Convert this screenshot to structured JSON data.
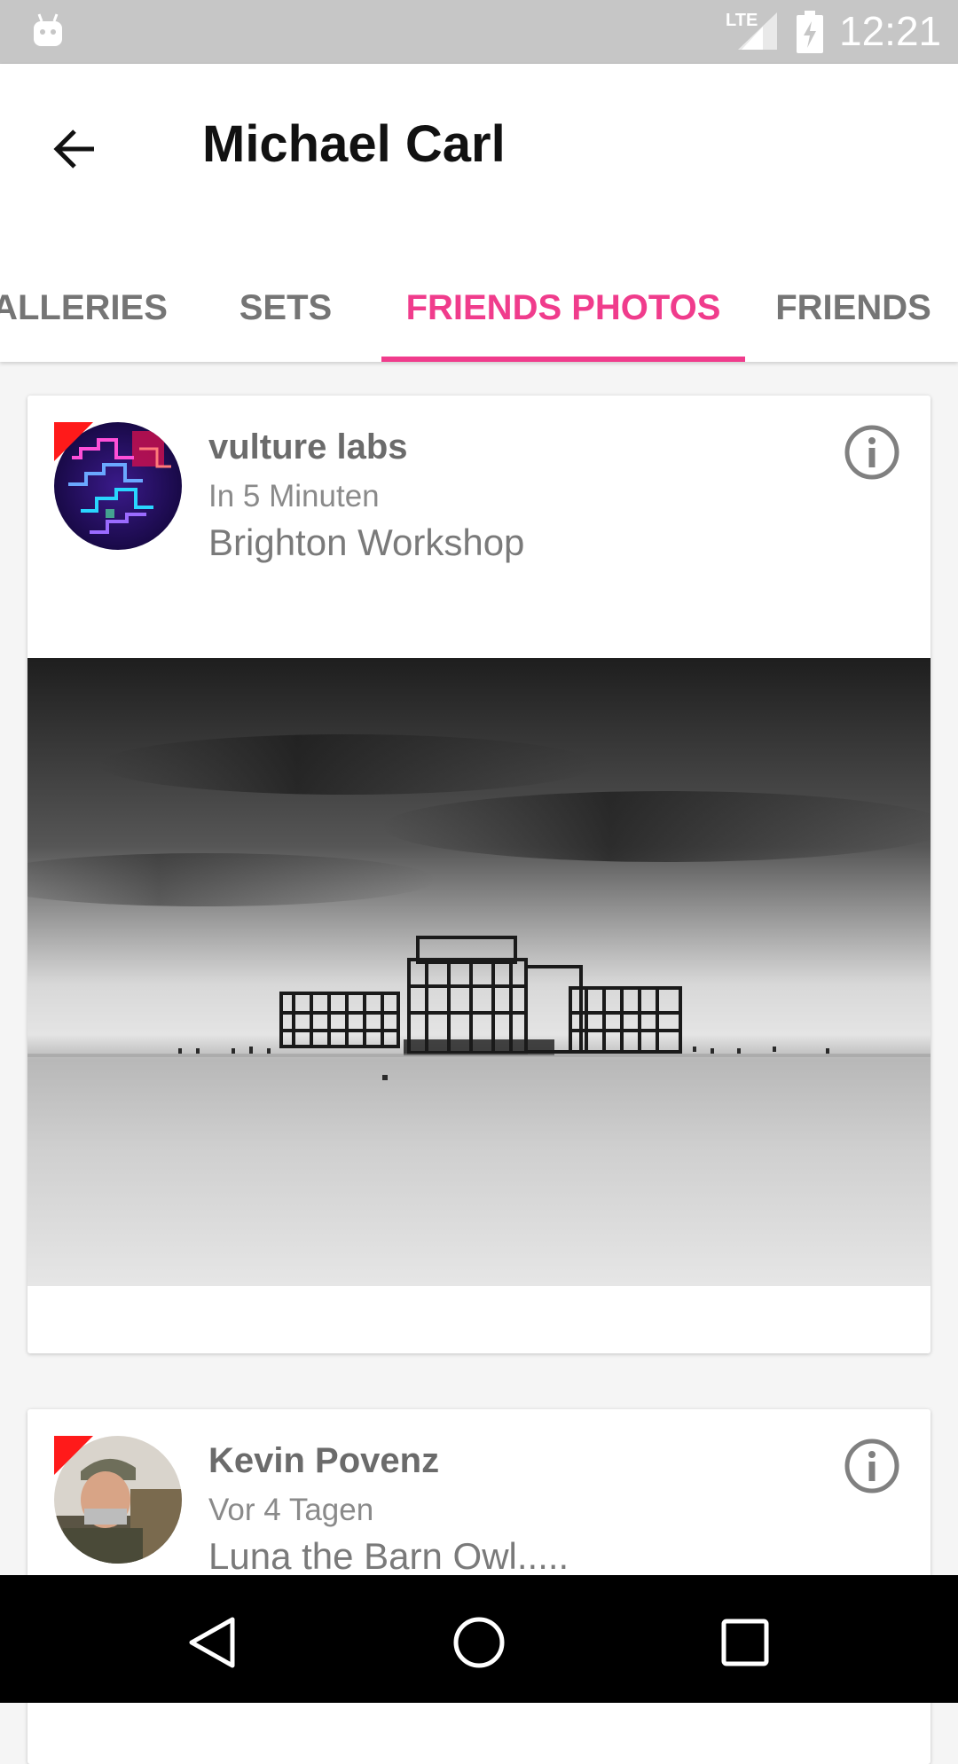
{
  "status_bar": {
    "time": "12:21",
    "network": "LTE",
    "icons": [
      "android-icon",
      "lte-signal-icon",
      "battery-charging-icon"
    ]
  },
  "app_bar": {
    "title": "Michael Carl",
    "back_icon": "arrow-left-icon"
  },
  "tabs": [
    {
      "label": "GALLERIES",
      "visible_label": "ALLERIES",
      "active": false
    },
    {
      "label": "SETS",
      "visible_label": "SETS",
      "active": false
    },
    {
      "label": "FRIENDS PHOTOS",
      "visible_label": "FRIENDS PHOTOS",
      "active": true
    },
    {
      "label": "FRIENDS",
      "visible_label": "FRIENDS",
      "active": false
    }
  ],
  "feed": [
    {
      "name": "vulture labs",
      "time": "In 5 Minuten",
      "caption": "Brighton Workshop",
      "photo": "black-and-white long exposure of a ruined pier in the sea"
    },
    {
      "name": "Kevin Povenz",
      "time": "Vor 4 Tagen",
      "caption": "Luna the Barn Owl.....",
      "photo": ""
    }
  ],
  "colors": {
    "accent": "#f03c8c",
    "status_bar": "#c6c6c6",
    "flag": "#ff1a1a",
    "nav_bar": "#000000"
  },
  "nav_bar": {
    "buttons": [
      "back-triangle-icon",
      "home-circle-icon",
      "recents-square-icon"
    ]
  }
}
